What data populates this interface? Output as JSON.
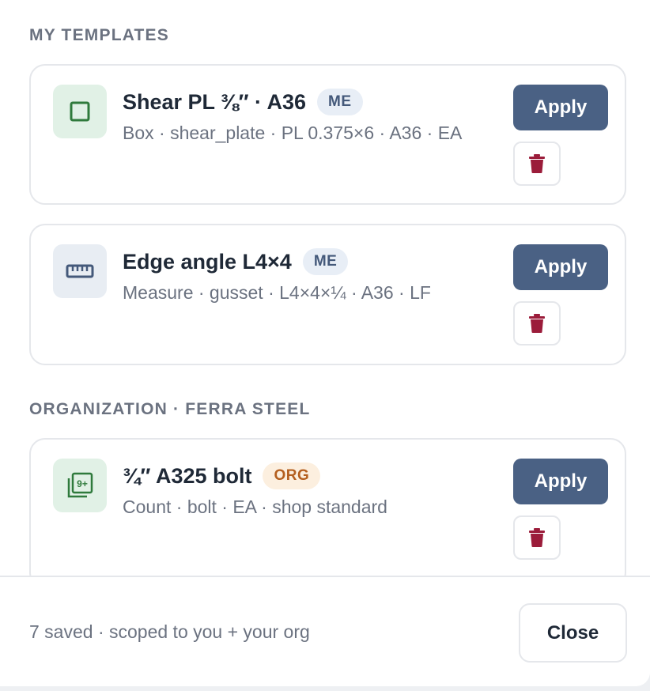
{
  "sections": {
    "mine": {
      "title": "MY TEMPLATES"
    },
    "org": {
      "title": "ORGANIZATION · FERRA STEEL"
    }
  },
  "templates": [
    {
      "name": "Shear PL ⅜″ · A36",
      "badge": "ME",
      "description": "Box · shear_plate · PL 0.375×6 · A36 · EA",
      "icon": "square-outline-icon",
      "apply_label": "Apply",
      "delete_icon": "trash-icon"
    },
    {
      "name": "Edge angle L4×4",
      "badge": "ME",
      "description": "Measure · gusset · L4×4×¼ · A36 · LF",
      "icon": "ruler-icon",
      "apply_label": "Apply",
      "delete_icon": "trash-icon"
    },
    {
      "name": "¾″ A325 bolt",
      "badge": "ORG",
      "description": "Count · bolt · EA · shop standard",
      "icon": "count-stack-icon",
      "apply_label": "Apply",
      "delete_icon": "trash-icon"
    }
  ],
  "footer": {
    "status": "7 saved · scoped to you + your org",
    "close_label": "Close"
  },
  "colors": {
    "primary": "#4a6184",
    "danger": "#9b1c3a",
    "green_icon": "#2f7a3c",
    "slate_icon": "#44597a",
    "org_badge": "#b45f1f"
  }
}
